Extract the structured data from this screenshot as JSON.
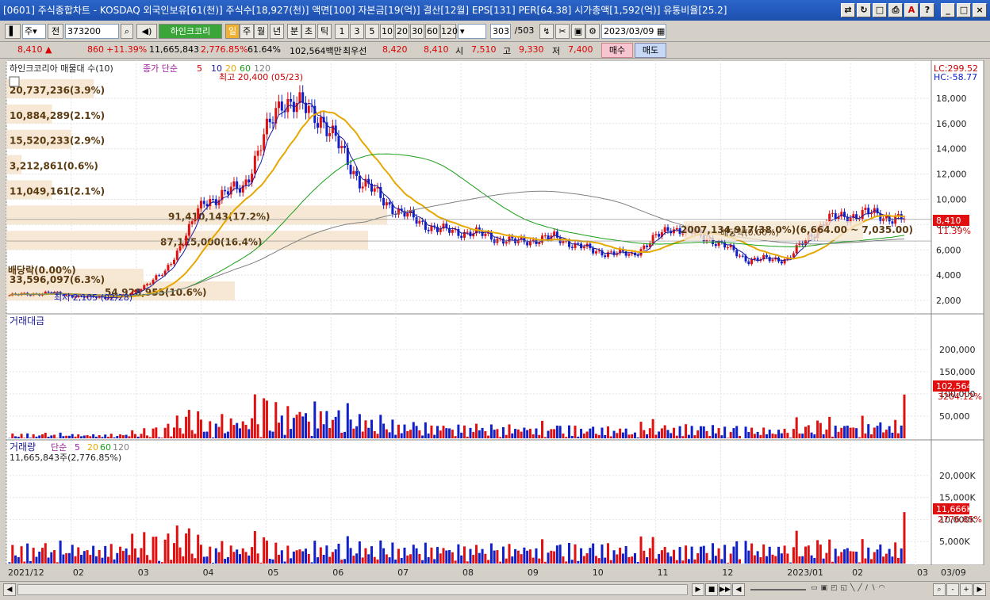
{
  "window": {
    "title": "[0601] 주식종합차트 - KOSDAQ 외국인보유[61(천)] 주식수[18,927(천)] 액면[100] 자본금[19(억)] 결산[12월] EPS[131] PER[64.38] 시가총액[1,592(억)] 유통비율[25.2]"
  },
  "toolbar": {
    "period_select": "주",
    "prev_label": "전",
    "stock_code": "373200",
    "stock_name": "하인크코리",
    "tabs": [
      "일",
      "주",
      "월",
      "년",
      "분",
      "초",
      "틱"
    ],
    "minutes": [
      "1",
      "3",
      "5",
      "10",
      "20",
      "30",
      "60",
      "120"
    ],
    "count_value": "303",
    "count_total": "/503",
    "date": "2023/03/09"
  },
  "quote": {
    "price": "8,410",
    "change": "860",
    "change_pct": "+11.39%",
    "volume": "11,665,843",
    "volume_ratio": "2,776.85%",
    "turnover": "61.64%",
    "amount": "102,564백만",
    "best_priority": "최우선",
    "ask": "8,420",
    "bid": "8,410",
    "open_label": "시",
    "open": "7,510",
    "high_label": "고",
    "high": "9,330",
    "low_label": "저",
    "low": "7,400",
    "buy_label": "매수",
    "sell_label": "매도"
  },
  "chart_data": {
    "type": "candlestick",
    "price_panel": {
      "legend_title": "하인크코리아 매물대 수(10)",
      "ma_label": "종가 단순",
      "ma_periods": [
        "5",
        "10",
        "20",
        "60",
        "120"
      ],
      "lc": "LC:299.52",
      "hc": "HC:-58.77",
      "ylim": [
        1000,
        20000
      ],
      "y_ticks": [
        2000,
        4000,
        6000,
        8000,
        10000,
        12000,
        14000,
        16000,
        18000
      ],
      "y_tick_labels": [
        "2,000",
        "4,000",
        "6,000",
        "8,000",
        "10,000",
        "12,000",
        "14,000",
        "16,000",
        "18,000"
      ],
      "last_price": "8,410",
      "last_change": "11.39%",
      "high_note": "최고 20,400 (05/23)",
      "low_note": "최저 2,105 (02/28)"
    },
    "volume_profile": [
      {
        "label": "54,928,955(10.6%)",
        "price": 2000,
        "ratio": 0.6
      },
      {
        "label": "33,596,097(6.3%)",
        "price": 3000,
        "ratio": 0.36
      },
      {
        "label": "87,125,000(16.4%)",
        "price": 6000,
        "ratio": 0.95
      },
      {
        "label": "91,410,143(17.2%)",
        "price": 8000,
        "ratio": 1.0
      },
      {
        "label": "11,049,161(2.1%)",
        "price": 10000,
        "ratio": 0.12
      },
      {
        "label": "3,212,861(0.6%)",
        "price": 12000,
        "ratio": 0.04
      },
      {
        "label": "15,520,233(2.9%)",
        "price": 14000,
        "ratio": 0.17
      },
      {
        "label": "10,884,289(2.1%)",
        "price": 16000,
        "ratio": 0.12
      },
      {
        "label": "20,737,236(3.9%)",
        "price": 18000,
        "ratio": 0.23
      }
    ],
    "annotations": [
      "배당락(0.00%)",
      "2007,134,917(38.0%)(6,664.00 ~ 7,035.00)",
      "배당락(0.00%)"
    ],
    "amount_panel": {
      "title": "거래대금",
      "ylim": [
        0,
        250000
      ],
      "y_tick_labels": [
        "50,000",
        "100,000",
        "150,000",
        "200,000"
      ],
      "last": "102,564",
      "last_ratio": "3204.12%"
    },
    "volume_panel": {
      "title": "거래량",
      "ma_label": "단순",
      "ma_periods": [
        "5",
        "20",
        "60",
        "120"
      ],
      "summary": "11,665,843주(2,776.85%)",
      "ylim": [
        0,
        25000
      ],
      "y_tick_labels": [
        "5,000K",
        "10,000K",
        "15,000K",
        "20,000K"
      ],
      "last": "11,666K",
      "last_ratio": "2776.85%"
    },
    "x_tick_labels": [
      "2021/12",
      "02",
      "03",
      "04",
      "05",
      "06",
      "07",
      "08",
      "09",
      "10",
      "11",
      "12",
      "2023/01",
      "02",
      "03",
      "03/09"
    ],
    "colors": {
      "up": "#e01010",
      "down": "#1020c8",
      "ma5": "#1a1aa0",
      "ma20": "#e6a800",
      "ma60": "#18a018",
      "ma120": "#808080",
      "bg": "#ffffff"
    },
    "price_series": [
      {
        "date": "2021/12",
        "close": 2400
      },
      {
        "date": "2022/01",
        "close": 2600
      },
      {
        "date": "2022/02",
        "close": 2250
      },
      {
        "date": "2022/03",
        "close": 2300
      },
      {
        "date": "2022/04",
        "close": 4200
      },
      {
        "date": "2022/04b",
        "close": 9800
      },
      {
        "date": "2022/05",
        "close": 11000
      },
      {
        "date": "2022/05b",
        "close": 18000
      },
      {
        "date": "2022/06",
        "close": 16500
      },
      {
        "date": "2022/06b",
        "close": 11500
      },
      {
        "date": "2022/07",
        "close": 9000
      },
      {
        "date": "2022/07b",
        "close": 7600
      },
      {
        "date": "2022/08",
        "close": 7300
      },
      {
        "date": "2022/09",
        "close": 6600
      },
      {
        "date": "2022/09b",
        "close": 7000
      },
      {
        "date": "2022/10",
        "close": 5900
      },
      {
        "date": "2022/11",
        "close": 5600
      },
      {
        "date": "2022/11b",
        "close": 7800
      },
      {
        "date": "2022/12",
        "close": 6900
      },
      {
        "date": "2023/01",
        "close": 5200
      },
      {
        "date": "2023/01b",
        "close": 5300
      },
      {
        "date": "2023/02",
        "close": 8400
      },
      {
        "date": "2023/02b",
        "close": 8900
      },
      {
        "date": "2023/03",
        "close": 8410
      }
    ]
  },
  "nav": {
    "items": [
      "▶",
      "■",
      "▶▶",
      "◀"
    ],
    "zoom": [
      "-",
      "+"
    ]
  }
}
